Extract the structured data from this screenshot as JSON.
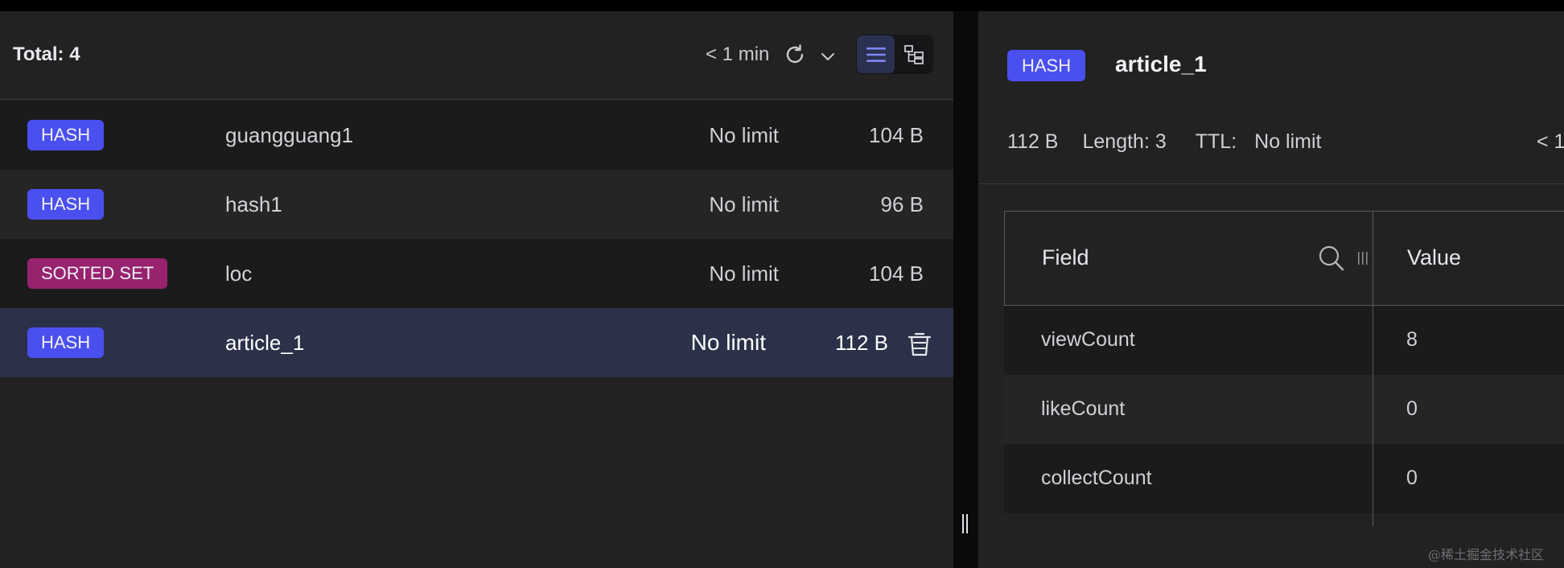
{
  "colors": {
    "hash_badge": "#4a4ff0",
    "zset_badge": "#97236e",
    "accent": "#7f86f6",
    "selected_row": "#2b3148"
  },
  "key_list": {
    "total_label": "Total: 4",
    "last_refresh": "< 1 min",
    "refresh_icon": "refresh-icon",
    "dropdown_icon": "chevron-down-icon",
    "view_modes": [
      "list-view-icon",
      "tree-view-icon"
    ],
    "active_view": "list",
    "rows": [
      {
        "type": "HASH",
        "name": "guangguang1",
        "ttl": "No limit",
        "size": "104 B"
      },
      {
        "type": "HASH",
        "name": "hash1",
        "ttl": "No limit",
        "size": "96 B"
      },
      {
        "type": "SORTED SET",
        "name": "loc",
        "ttl": "No limit",
        "size": "104 B"
      },
      {
        "type": "HASH",
        "name": "article_1",
        "ttl": "No limit",
        "size": "112 B"
      }
    ],
    "selected_index": 3
  },
  "detail": {
    "type": "HASH",
    "key": "article_1",
    "size": "112 B",
    "length": "Length: 3",
    "ttl_label": "TTL:",
    "ttl_value": "No limit",
    "last_refresh": "< 1",
    "table": {
      "field_header": "Field",
      "value_header": "Value",
      "rows": [
        {
          "field": "viewCount",
          "value": "8"
        },
        {
          "field": "likeCount",
          "value": "0"
        },
        {
          "field": "collectCount",
          "value": "0"
        }
      ]
    }
  },
  "watermark": "@稀土掘金技术社区"
}
